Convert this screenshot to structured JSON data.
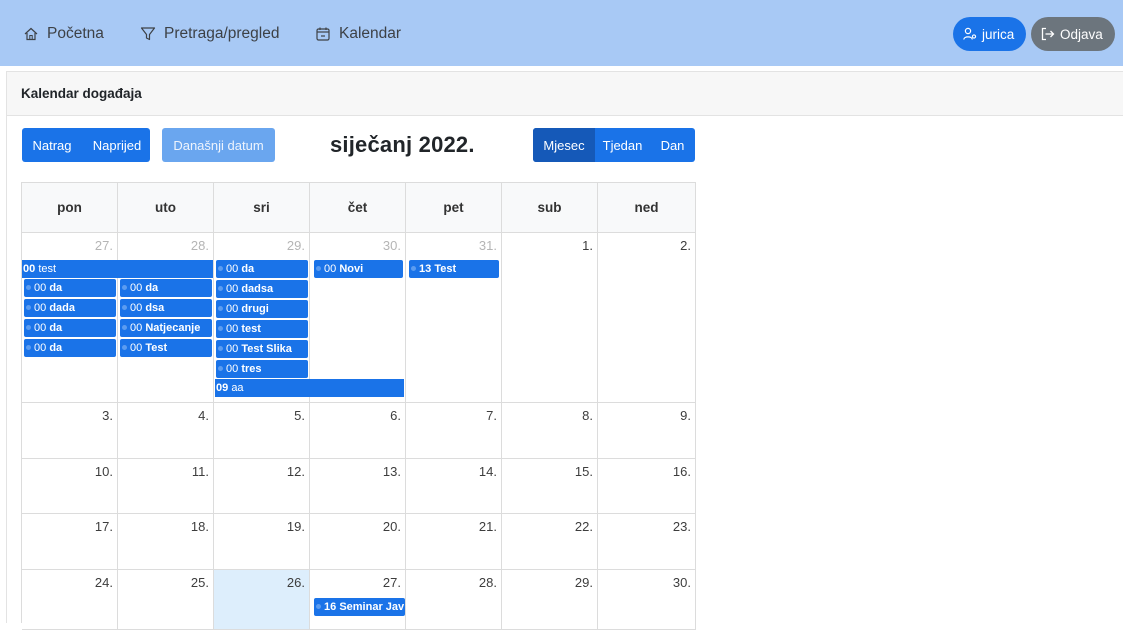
{
  "nav": {
    "home": "Početna",
    "search": "Pretraga/pregled",
    "calendar": "Kalendar",
    "user": "jurica",
    "logout": "Odjava"
  },
  "card": {
    "title": "Kalendar događaja"
  },
  "toolbar": {
    "back": "Natrag",
    "next": "Naprijed",
    "today": "Današnji datum",
    "title": "siječanj 2022.",
    "views": [
      "Mjesec",
      "Tjedan",
      "Dan"
    ],
    "active_view": "Mjesec"
  },
  "weekdays": [
    "pon",
    "uto",
    "sri",
    "čet",
    "pet",
    "sub",
    "ned"
  ],
  "weeks": [
    [
      "27.",
      "28.",
      "29.",
      "30.",
      "31.",
      "1.",
      "2."
    ],
    [
      "3.",
      "4.",
      "5.",
      "6.",
      "7.",
      "8.",
      "9."
    ],
    [
      "10.",
      "11.",
      "12.",
      "13.",
      "14.",
      "15.",
      "16."
    ],
    [
      "17.",
      "18.",
      "19.",
      "20.",
      "21.",
      "22.",
      "23."
    ],
    [
      "24.",
      "25.",
      "26.",
      "27.",
      "28.",
      "29.",
      "30."
    ]
  ],
  "events": {
    "w1_bar_top": {
      "time": "00",
      "title": "test"
    },
    "w1_bar_bottom": {
      "time": "09",
      "title": "aa"
    },
    "mon": [
      {
        "time": "00",
        "title": "da"
      },
      {
        "time": "00",
        "title": "dada"
      },
      {
        "time": "00",
        "title": "da"
      },
      {
        "time": "00",
        "title": "da"
      }
    ],
    "tue": [
      {
        "time": "00",
        "title": "da"
      },
      {
        "time": "00",
        "title": "dsa"
      },
      {
        "time": "00",
        "title": "Natjecanje"
      },
      {
        "time": "00",
        "title": "Test"
      }
    ],
    "wed": [
      {
        "time": "00",
        "title": "da"
      },
      {
        "time": "00",
        "title": "dadsa"
      },
      {
        "time": "00",
        "title": "drugi"
      },
      {
        "time": "00",
        "title": "test"
      },
      {
        "time": "00",
        "title": "Test Slika"
      },
      {
        "time": "00",
        "title": "tres"
      }
    ],
    "thu": {
      "time": "00",
      "title": "Novi"
    },
    "fri": {
      "time": "13",
      "title": "Test"
    },
    "w5_thu": {
      "time": "16",
      "title": "Seminar Jav"
    }
  },
  "colors": {
    "navbar": "#a8c9f5",
    "primary": "#1a73e8",
    "active": "#1559b8",
    "secondary": "#6c757d",
    "today": "#ddeefc"
  }
}
